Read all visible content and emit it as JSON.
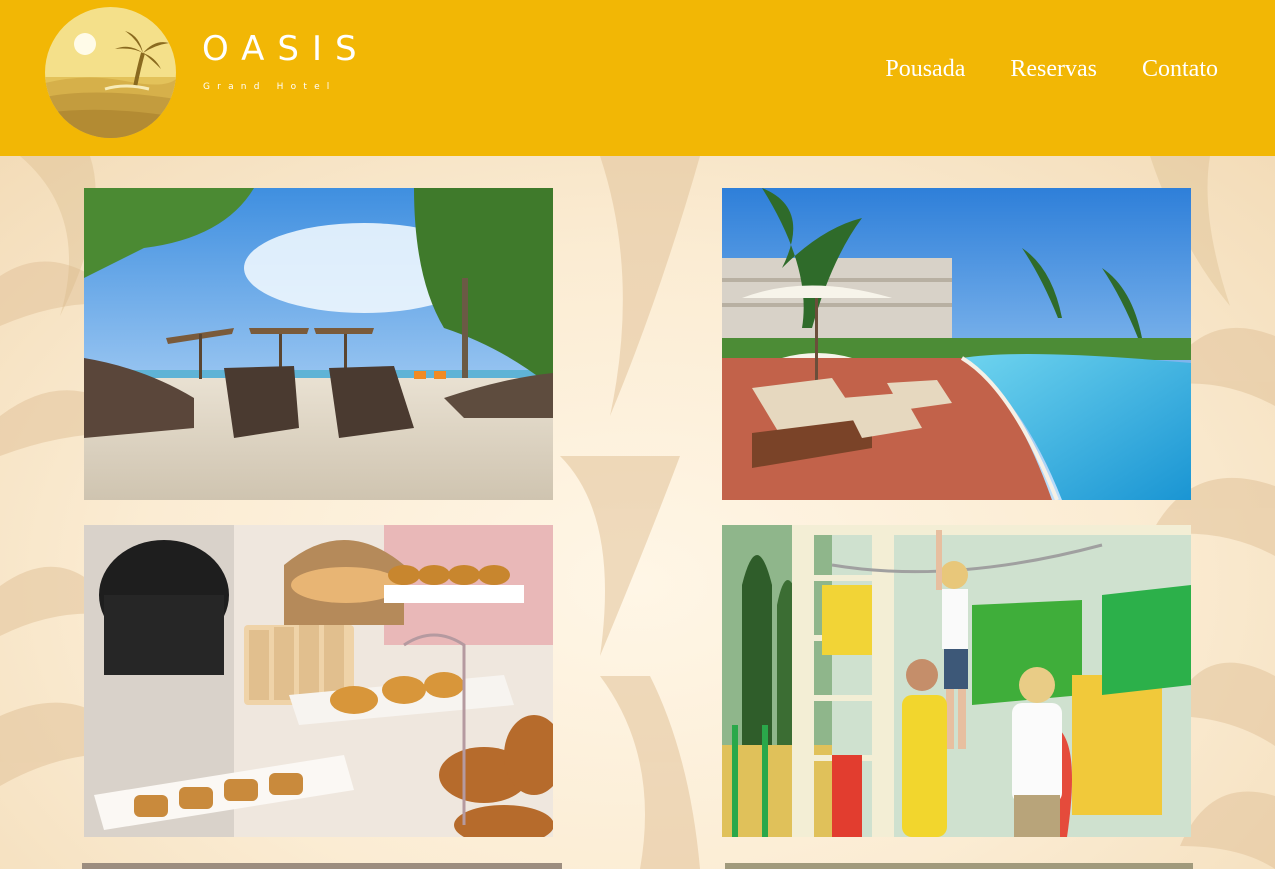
{
  "header": {
    "brand_name": "OASIS",
    "brand_tagline": "Grand Hotel",
    "logo_icon": "sun-palm-island-logo",
    "background_color": "#f2b705"
  },
  "nav": {
    "items": [
      {
        "label": "Pousada"
      },
      {
        "label": "Reservas"
      },
      {
        "label": "Contato"
      }
    ]
  },
  "gallery": {
    "photos": [
      {
        "name": "beach-loungers-photo",
        "subject": "beach-loungers-umbrellas"
      },
      {
        "name": "pool-terrace-photo",
        "subject": "resort-pool-terrace"
      },
      {
        "name": "breakfast-buffet-photo",
        "subject": "bread-pastry-buffet"
      },
      {
        "name": "playground-photo",
        "subject": "family-kids-playground"
      }
    ]
  },
  "colors": {
    "accent": "#f2b705",
    "text_on_accent": "#ffffff",
    "page_background": "#fbefdc"
  }
}
